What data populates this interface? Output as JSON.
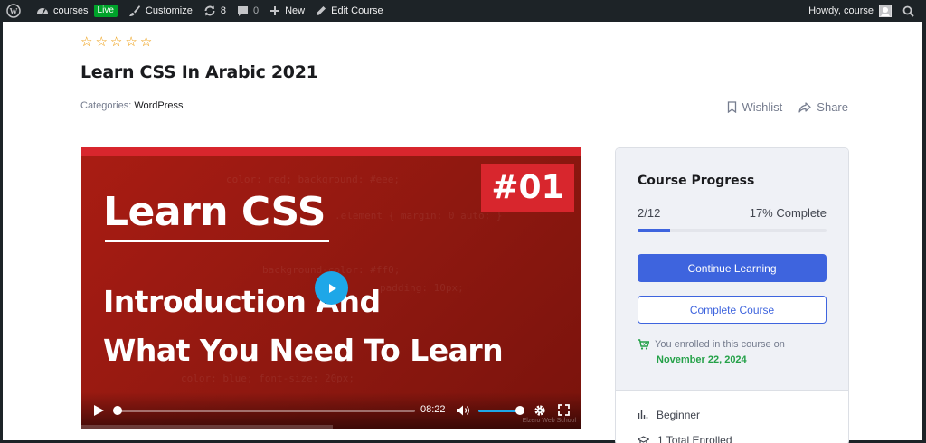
{
  "admin_bar": {
    "site_name": "courses",
    "live_badge": "Live",
    "customize": "Customize",
    "updates_count": "8",
    "comments_count": "0",
    "new": "New",
    "edit_course": "Edit Course",
    "greeting": "Howdy, course"
  },
  "course": {
    "rating_stars": [
      "☆",
      "☆",
      "☆",
      "☆",
      "☆"
    ],
    "title": "Learn CSS In Arabic 2021",
    "categories_label": "Categories:",
    "category": "WordPress",
    "wishlist": "Wishlist",
    "share": "Share"
  },
  "video": {
    "episode_badge": "#01",
    "headline": "Learn CSS",
    "subtitle_line1": "Introduction And",
    "subtitle_line2": "What You Need To Learn",
    "time": "08:22",
    "watermark": "Elzero Web School",
    "seek_fraction": 0.0,
    "volume_fraction": 1.0
  },
  "progress_card": {
    "title": "Course Progress",
    "count": "2/12",
    "percent_label": "17% Complete",
    "percent_value": 17,
    "continue_button": "Continue Learning",
    "complete_button": "Complete Course",
    "enrolled_text": "You enrolled in this course on",
    "enrolled_date": "November 22, 2024",
    "level": "Beginner",
    "enrolled_total": "1 Total Enrolled"
  },
  "colors": {
    "accent": "#3e64de",
    "success": "#24a148",
    "star": "#ed9700",
    "video_red": "#d8262d"
  }
}
